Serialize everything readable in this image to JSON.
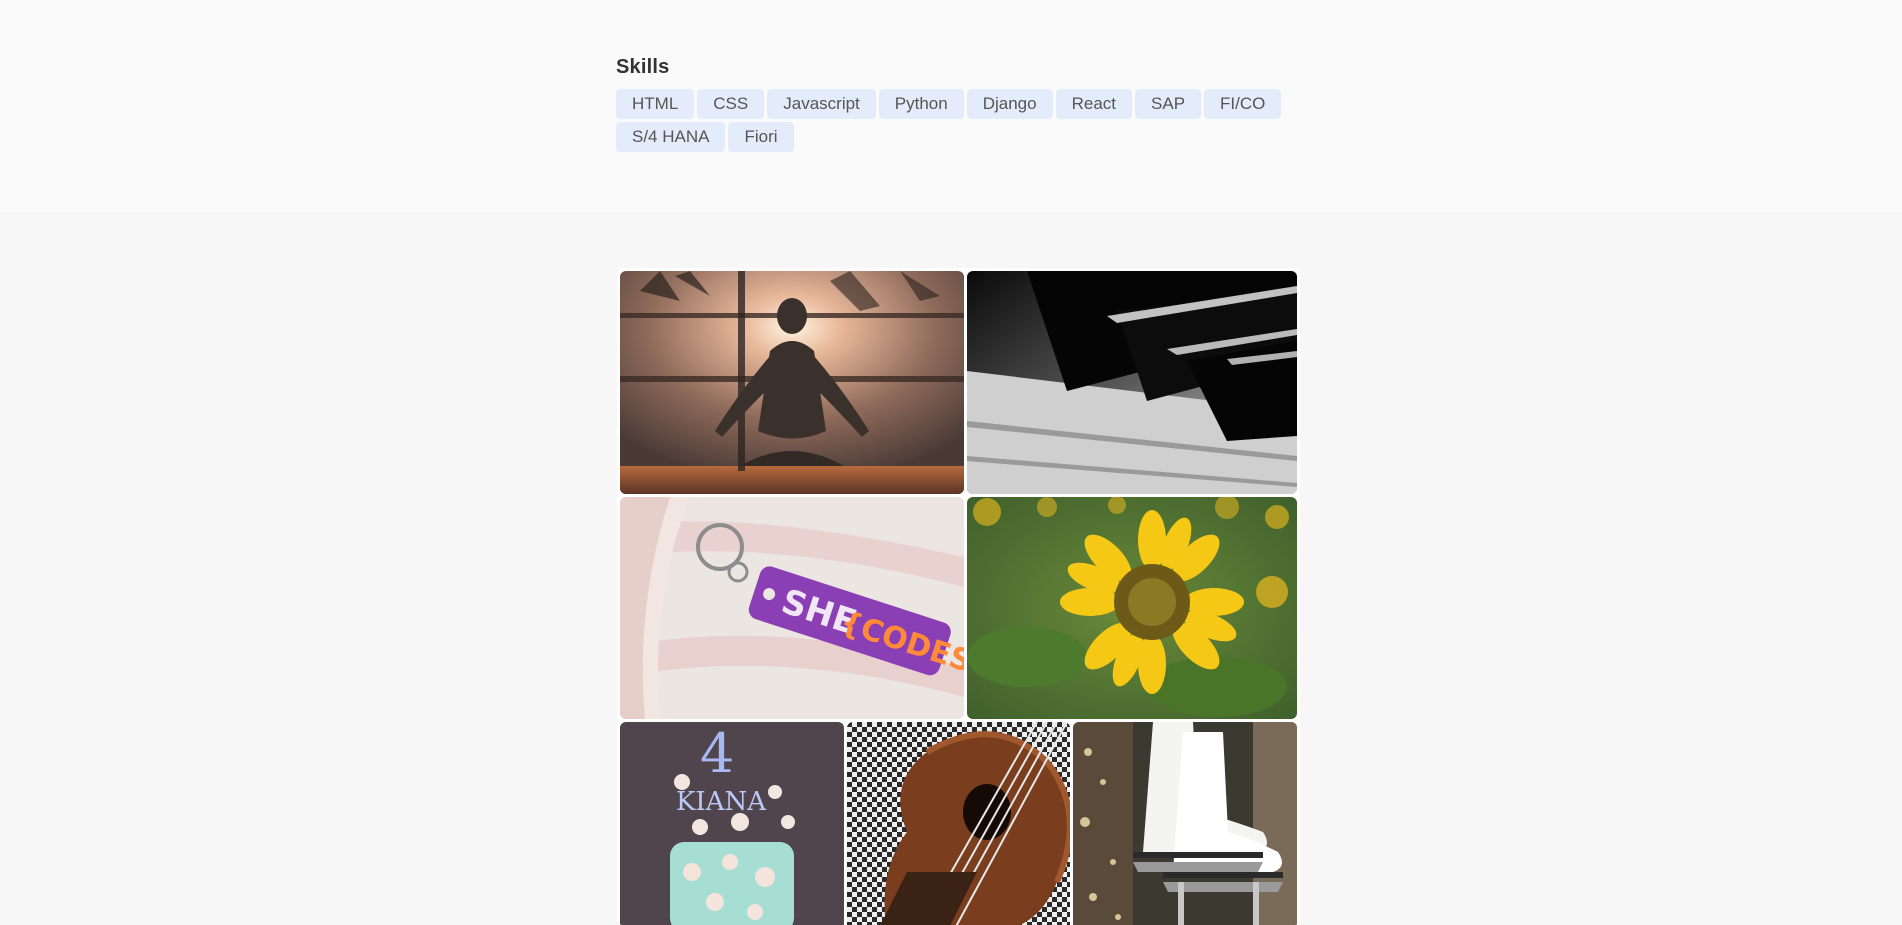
{
  "skills": {
    "heading": "Skills",
    "items": [
      "HTML",
      "CSS",
      "Javascript",
      "Python",
      "Django",
      "React",
      "SAP",
      "FI/CO",
      "S/4 HANA",
      "Fiori"
    ]
  },
  "gallery": {
    "photos": [
      {
        "name": "yoga-photo",
        "subject": "person meditating at sunset"
      },
      {
        "name": "piano-photo",
        "subject": "piano keys close-up"
      },
      {
        "name": "keychain-photo",
        "subject": "SheCodes keychain",
        "text_left": "SHE",
        "text_right": "{CODES}"
      },
      {
        "name": "sunflower-photo",
        "subject": "sunflower field"
      },
      {
        "name": "cake-photo",
        "subject": "birthday cake",
        "number": "4",
        "cake_name": "KIANA"
      },
      {
        "name": "ukulele-photo",
        "subject": "ukulele"
      },
      {
        "name": "skates-photo",
        "subject": "white ice skates"
      }
    ]
  },
  "colors": {
    "page_bg": "#f7f7f7",
    "skills_bg": "#fafafa",
    "badge_bg": "#e4ecfb",
    "badge_text": "#555555",
    "keychain_purple": "#8a3fb5",
    "keychain_orange": "#ff8a3a"
  }
}
